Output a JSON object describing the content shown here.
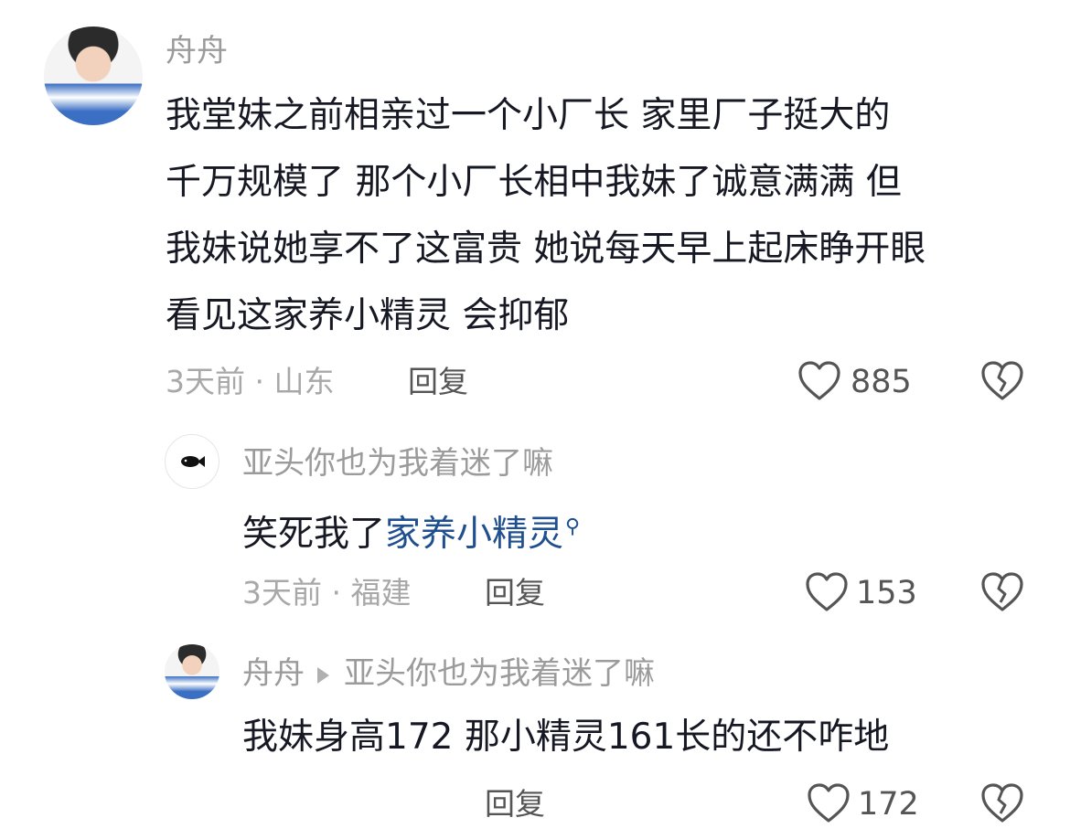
{
  "comment1": {
    "username": "舟舟",
    "lines": [
      "我堂妹之前相亲过一个小厂长 家里厂子挺大的",
      "千万规模了  那个小厂长相中我妹了诚意满满 但",
      "我妹说她享不了这富贵 她说每天早上起床睁开眼",
      "看见这家养小精灵 会抑郁"
    ],
    "meta": "3天前 · 山东",
    "reply_label": "回复",
    "likes": "885"
  },
  "reply1": {
    "username": "亚头你也为我着迷了嘛",
    "text_prefix": "笑死我了",
    "link_text": "家养小精灵",
    "search_glyph": "⚲",
    "meta": "3天前 · 福建",
    "reply_label": "回复",
    "likes": "153"
  },
  "reply2": {
    "username": "舟舟",
    "reply_to": "亚头你也为我着迷了嘛",
    "text": "我妹身高172  那小精灵161长的还不咋地",
    "reply_label": "回复",
    "likes": "172"
  },
  "colors": {
    "link": "#1f4f8f",
    "meta": "#a8a8a8",
    "text": "#161823"
  },
  "icons": {
    "like": "heart-outline-icon",
    "dislike": "broken-heart-icon"
  }
}
